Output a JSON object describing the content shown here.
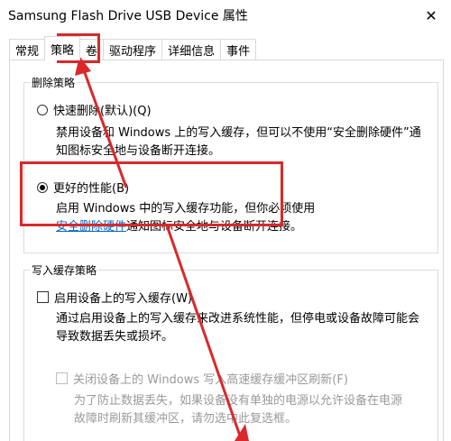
{
  "window": {
    "title": "Samsung Flash Drive USB Device 属性",
    "close_glyph": "✕"
  },
  "tabs": [
    {
      "label": "常规"
    },
    {
      "label": "策略",
      "active": true
    },
    {
      "label": "卷"
    },
    {
      "label": "驱动程序"
    },
    {
      "label": "详细信息"
    },
    {
      "label": "事件"
    }
  ],
  "removal_policy": {
    "title": "删除策略",
    "quick_removal": {
      "label": "快速删除(默认)(Q)",
      "selected": false,
      "desc_line1": "禁用设备和 Windows 上的写入缓存，但可以不使用“安全删除硬件”通",
      "desc_line2": "知图标安全地与设备断开连接。"
    },
    "better_performance": {
      "label": "更好的性能(B)",
      "selected": true,
      "desc_line1": "启用 Windows 中的写入缓存功能，但你必须使用",
      "desc_link": "安全删除硬件",
      "desc_line2_rest": "通知图标安全地与设备断开连接。"
    }
  },
  "write_cache_policy": {
    "title": "写入缓存策略",
    "enable_write_cache": {
      "label": "启用设备上的写入缓存(W)",
      "checked": false,
      "desc_line1": "通过启用设备上的写入缓存来改进系统性能，但停电或设备故障可能会",
      "desc_line2": "导致数据丢失或损坏。"
    },
    "disable_flush": {
      "label": "关闭设备上的 Windows 写入高速缓存缓冲区刷新(F)",
      "checked": false,
      "enabled": false,
      "desc_line1": "为了防止数据丢失，如果设备没有单独的电源以允许设备在电源",
      "desc_line2": "故障时刷新其缓冲区，请勿选中此复选框。"
    }
  },
  "colors": {
    "highlight": "#d9292a",
    "link": "#0066cc",
    "disabled_text": "#9a9a9a"
  }
}
